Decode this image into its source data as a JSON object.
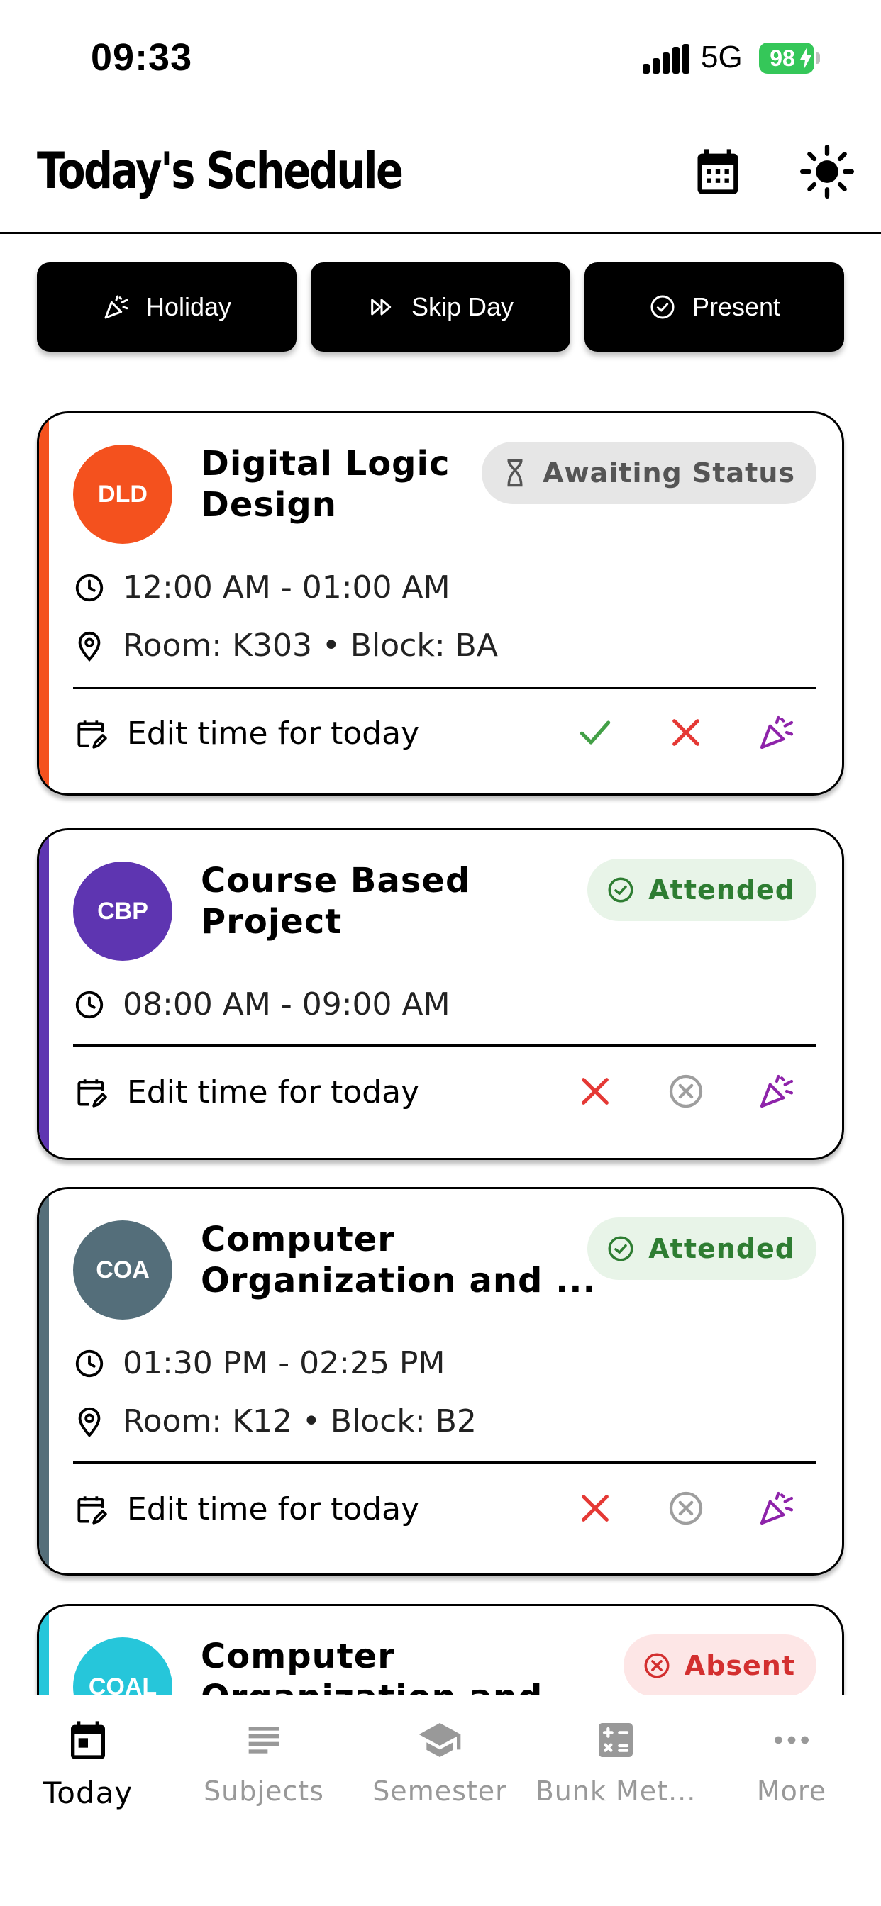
{
  "status_bar": {
    "time": "09:33",
    "network": "5G",
    "battery": "98"
  },
  "header": {
    "title": "Today's Schedule",
    "calendar_icon": "calendar-icon",
    "theme_icon": "sun-icon"
  },
  "quick_actions": [
    {
      "label": "Holiday",
      "icon": "party-popper-icon"
    },
    {
      "label": "Skip Day",
      "icon": "fast-forward-icon"
    },
    {
      "label": "Present",
      "icon": "check-circle-icon"
    }
  ],
  "classes": [
    {
      "abbr": "DLD",
      "title_line1": "Digital Logic",
      "title_line2": "Design",
      "color": "#f4511e",
      "status": "Awaiting Status",
      "time": "12:00 AM - 01:00 AM",
      "location": "Room: K303 • Block: BA",
      "edit_label": "Edit time for today"
    },
    {
      "abbr": "CBP",
      "title_line1": "Course Based",
      "title_line2": "Project",
      "color": "#5e35b1",
      "status": "Attended",
      "time": "08:00 AM - 09:00 AM",
      "edit_label": "Edit time for today"
    },
    {
      "abbr": "COA",
      "title_line1": "Computer",
      "title_line2": "Organization and ...",
      "color": "#546e7a",
      "status": "Attended",
      "time": "01:30 PM - 02:25 PM",
      "location": "Room: K12 • Block: B2",
      "edit_label": "Edit time for today"
    },
    {
      "abbr": "COAL",
      "title_line1": "Computer",
      "title_line2": "Organization and Ar...",
      "color": "#26c6da",
      "status": "Absent"
    }
  ],
  "nav": [
    {
      "label": "Today",
      "icon": "calendar-today-icon",
      "active": true
    },
    {
      "label": "Subjects",
      "icon": "list-icon"
    },
    {
      "label": "Semester",
      "icon": "graduation-cap-icon"
    },
    {
      "label": "Bunk Met...",
      "icon": "calculator-icon"
    },
    {
      "label": "More",
      "icon": "more-dots-icon"
    }
  ],
  "colors": {
    "attended": "#2e7d32",
    "absent": "#d32f2f",
    "present_check": "#43a047",
    "celebrate": "#8e24aa",
    "awaiting": "#555555"
  }
}
